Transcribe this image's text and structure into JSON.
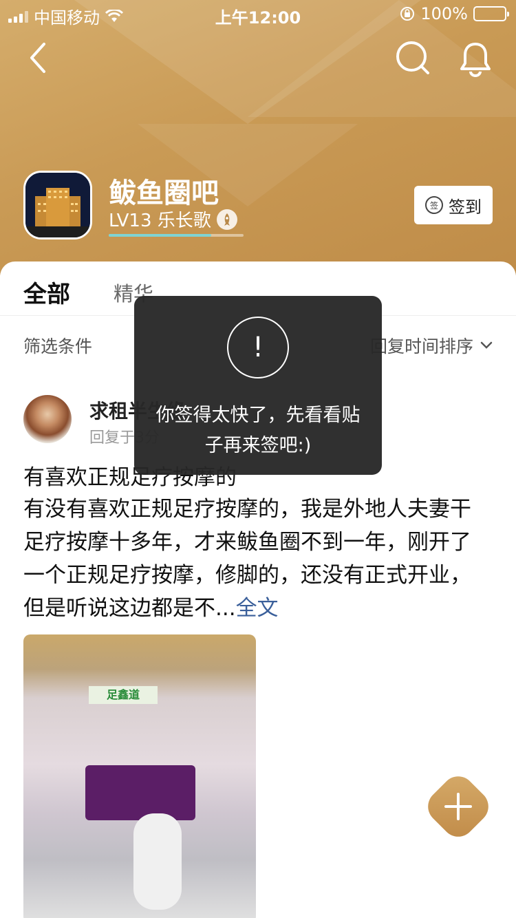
{
  "status_bar": {
    "carrier": "中国移动",
    "time": "上午12:00",
    "battery": "100%"
  },
  "forum": {
    "name": "鲅鱼圈吧",
    "level": "LV13 乐长歌",
    "level_progress": 0.76,
    "signin_label": "签到",
    "signin_icon_text": "签"
  },
  "tabs": [
    "全部",
    "精华"
  ],
  "filter": {
    "left_label": "筛选条件",
    "sort_label": "回复时间排序"
  },
  "post": {
    "author": "求租半生缘",
    "time": "回复于3分",
    "title": "有喜欢正规足疗按摩的",
    "body": "有没有喜欢正规足疗按摩的，我是外地人夫妻干足疗按摩十多年，才来鲅鱼圈不到一年，刚开了一个正规足疗按摩，修脚的，还没有正式开业，但是听说这边都是不...",
    "more_label": "全文",
    "image_sign": "足鑫道"
  },
  "toast": {
    "icon": "!",
    "message": "你签得太快了，先看看贴子再来签吧:)"
  },
  "colors": {
    "header_gold": "#c99a55",
    "fab_gold": "#c89a58",
    "link_blue": "#3a5f9a"
  }
}
